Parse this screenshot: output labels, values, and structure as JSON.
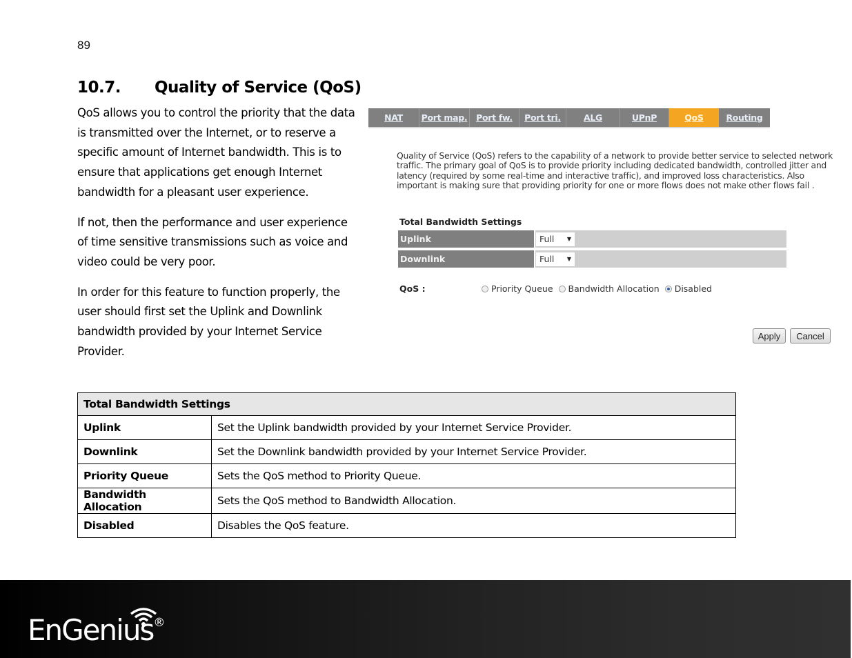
{
  "page_number": "89",
  "heading": {
    "number": "10.7.",
    "title": "Quality of Service (QoS)"
  },
  "intro_paragraphs": [
    "QoS allows you to control the priority that the data is transmitted over the Internet, or to reserve a specific amount of Internet bandwidth. This is to ensure that applications get enough Internet bandwidth for a pleasant user experience.",
    "If not, then the performance and user experience of time sensitive transmissions such as voice and video could be very poor.",
    "In order for this feature to function properly, the user should first set the Uplink and Downlink bandwidth provided by your Internet Service Provider."
  ],
  "screenshot": {
    "tabs": [
      {
        "label": "NAT",
        "active": false
      },
      {
        "label": "Port map.",
        "active": false
      },
      {
        "label": "Port fw.",
        "active": false
      },
      {
        "label": "Port tri.",
        "active": false
      },
      {
        "label": "ALG",
        "active": false
      },
      {
        "label": "UPnP",
        "active": false
      },
      {
        "label": "QoS",
        "active": true
      },
      {
        "label": "Routing",
        "active": false
      }
    ],
    "description": "Quality of Service (QoS) refers to the capability of a network to provide better service to selected network traffic. The primary goal of QoS is to provide priority including dedicated bandwidth, controlled jitter and latency (required by some real-time and interactive traffic), and improved loss characteristics. Also important is making sure that providing priority for one or more flows does not make other flows fail .",
    "section_title": "Total Bandwidth Settings",
    "uplink": {
      "label": "Uplink",
      "value": "Full"
    },
    "downlink": {
      "label": "Downlink",
      "value": "Full"
    },
    "qos": {
      "label": "QoS :",
      "options": [
        {
          "label": "Priority Queue",
          "checked": false
        },
        {
          "label": "Bandwidth Allocation",
          "checked": false
        },
        {
          "label": "Disabled",
          "checked": true
        }
      ]
    },
    "buttons": {
      "apply": "Apply",
      "cancel": "Cancel"
    },
    "colors": {
      "tab_bg": "#808080",
      "tab_active": "#f4a623",
      "label_bg": "#7f7f7f",
      "value_bg": "#cfcfcf"
    }
  },
  "table": {
    "header": "Total Bandwidth Settings",
    "rows": [
      {
        "term": "Uplink",
        "desc": "Set the Uplink bandwidth provided by your Internet Service Provider."
      },
      {
        "term": "Downlink",
        "desc": "Set the Downlink bandwidth provided by your Internet Service Provider."
      },
      {
        "term": "Priority Queue",
        "desc": "Sets the QoS method to Priority Queue."
      },
      {
        "term": "Bandwidth Allocation",
        "desc": "Sets the QoS method to Bandwidth Allocation."
      },
      {
        "term": "Disabled",
        "desc": "Disables the QoS feature."
      }
    ]
  },
  "footer": {
    "brand": "EnGenius",
    "registered": "®"
  }
}
